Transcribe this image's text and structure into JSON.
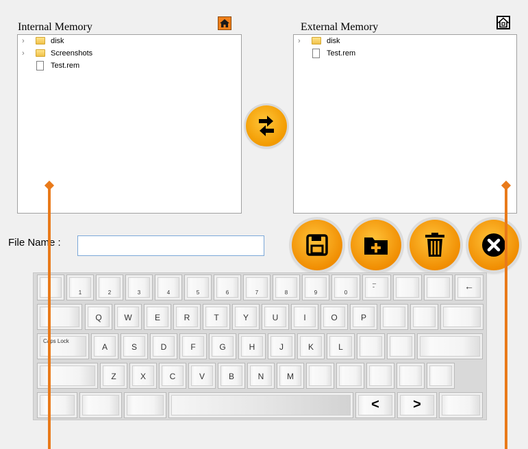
{
  "internal_panel": {
    "title": "Internal Memory",
    "items": [
      {
        "label": "disk",
        "type": "folder",
        "expandable": true
      },
      {
        "label": "Screenshots",
        "type": "folder",
        "expandable": true
      },
      {
        "label": "Test.rem",
        "type": "file",
        "expandable": false
      }
    ],
    "home_icon": "home-icon"
  },
  "external_panel": {
    "title": "External Memory",
    "items": [
      {
        "label": "disk",
        "type": "folder",
        "expandable": true
      },
      {
        "label": "Test.rem",
        "type": "file",
        "expandable": false
      }
    ],
    "home_icon": "home-device-icon"
  },
  "transfer_icon": "swap-arrows-icon",
  "file_name": {
    "label": "File Name :",
    "value": ""
  },
  "actions": [
    {
      "name": "save",
      "icon": "save-icon"
    },
    {
      "name": "new-folder",
      "icon": "new-folder-icon"
    },
    {
      "name": "delete",
      "icon": "trash-icon"
    },
    {
      "name": "close",
      "icon": "close-icon"
    }
  ],
  "keyboard": {
    "row1": [
      "",
      "1",
      "2",
      "3",
      "4",
      "5",
      "6",
      "7",
      "8",
      "9",
      "0",
      "_\n-",
      "",
      "",
      "←"
    ],
    "row2": [
      "",
      "Q",
      "W",
      "E",
      "R",
      "T",
      "Y",
      "U",
      "I",
      "O",
      "P",
      "",
      "",
      ""
    ],
    "row3": [
      "Caps Lock",
      "A",
      "S",
      "D",
      "F",
      "G",
      "H",
      "J",
      "K",
      "L",
      "",
      "",
      ""
    ],
    "row4": [
      "",
      "Z",
      "X",
      "C",
      "V",
      "B",
      "N",
      "M",
      "",
      "",
      "",
      "",
      ""
    ],
    "row5": [
      "",
      "",
      "",
      "",
      "<",
      ">",
      ""
    ]
  },
  "colors": {
    "accent": "#f29a00",
    "pointer": "#e97a1a"
  }
}
